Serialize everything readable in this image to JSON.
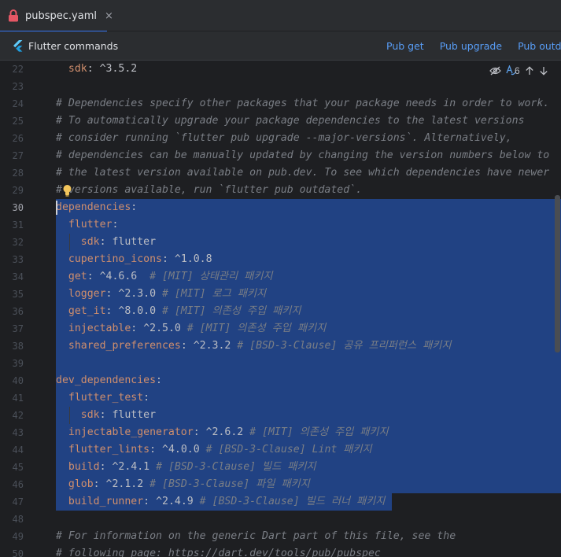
{
  "tab": {
    "label": "pubspec.yaml",
    "close": "×"
  },
  "notification": {
    "title": "Flutter commands",
    "actions": [
      "Pub get",
      "Pub upgrade",
      "Pub outdated"
    ]
  },
  "inspection": {
    "count": "6"
  },
  "editor": {
    "current_line": 30,
    "lines": [
      {
        "n": "22",
        "indent": 1,
        "key": "sdk",
        "value": " ^3.5.2",
        "comment": ""
      },
      {
        "n": "23",
        "text": ""
      },
      {
        "n": "24",
        "fullcomment": "# Dependencies specify other packages that your package needs in order to work."
      },
      {
        "n": "25",
        "fullcomment": "# To automatically upgrade your package dependencies to the latest versions"
      },
      {
        "n": "26",
        "fullcomment": "# consider running `flutter pub upgrade --major-versions`. Alternatively,"
      },
      {
        "n": "27",
        "fullcomment": "# dependencies can be manually updated by changing the version numbers below to"
      },
      {
        "n": "28",
        "fullcomment": "# the latest version available on pub.dev. To see which dependencies have newer"
      },
      {
        "n": "29",
        "fullcomment": "# versions available, run `flutter pub outdated`."
      },
      {
        "n": "30",
        "indent": 0,
        "key": "dependencies",
        "value": "",
        "comment": ""
      },
      {
        "n": "31",
        "indent": 1,
        "key": "flutter",
        "value": "",
        "comment": ""
      },
      {
        "n": "32",
        "indent": 2,
        "key": "sdk",
        "value": " flutter",
        "comment": ""
      },
      {
        "n": "33",
        "indent": 1,
        "key": "cupertino_icons",
        "value": " ^1.0.8",
        "comment": ""
      },
      {
        "n": "34",
        "indent": 1,
        "key": "get",
        "value": " ^4.6.6  ",
        "comment": "# [MIT] 상태관리 패키지"
      },
      {
        "n": "35",
        "indent": 1,
        "key": "logger",
        "value": " ^2.3.0 ",
        "comment": "# [MIT] 로그 패키지"
      },
      {
        "n": "36",
        "indent": 1,
        "key": "get_it",
        "value": " ^8.0.0 ",
        "comment": "# [MIT] 의존성 주입 패키지"
      },
      {
        "n": "37",
        "indent": 1,
        "key": "injectable",
        "value": " ^2.5.0 ",
        "comment": "# [MIT] 의존성 주입 패키지"
      },
      {
        "n": "38",
        "indent": 1,
        "key": "shared_preferences",
        "value": " ^2.3.2 ",
        "comment": "# [BSD-3-Clause] 공유 프리퍼런스 패키지"
      },
      {
        "n": "39",
        "text": ""
      },
      {
        "n": "40",
        "indent": 0,
        "key": "dev_dependencies",
        "value": "",
        "comment": ""
      },
      {
        "n": "41",
        "indent": 1,
        "key": "flutter_test",
        "value": "",
        "comment": ""
      },
      {
        "n": "42",
        "indent": 2,
        "key": "sdk",
        "value": " flutter",
        "comment": ""
      },
      {
        "n": "43",
        "indent": 1,
        "key": "injectable_generator",
        "value": " ^2.6.2 ",
        "comment": "# [MIT] 의존성 주입 패키지"
      },
      {
        "n": "44",
        "indent": 1,
        "key": "flutter_lints",
        "value": " ^4.0.0 ",
        "comment": "# [BSD-3-Clause] Lint 패키지"
      },
      {
        "n": "45",
        "indent": 1,
        "key": "build",
        "value": " ^2.4.1 ",
        "comment": "# [BSD-3-Clause] 빌드 패키지"
      },
      {
        "n": "46",
        "indent": 1,
        "key": "glob",
        "value": " ^2.1.2 ",
        "comment": "# [BSD-3-Clause] 파일 패키지"
      },
      {
        "n": "47",
        "indent": 1,
        "key": "build_runner",
        "value": " ^2.4.9 ",
        "comment": "# [BSD-3-Clause] 빌드 러너 패키지"
      },
      {
        "n": "48",
        "text": ""
      },
      {
        "n": "49",
        "fullcomment": "# For information on the generic Dart part of this file, see the"
      },
      {
        "n": "50",
        "fullcomment": "# following page: https://dart.dev/tools/pub/pubspec"
      }
    ]
  },
  "colors": {
    "background": "#1e1f22",
    "toolbar": "#2b2d30",
    "selection": "#214283",
    "key": "#cf8e6d",
    "comment": "#7a7e85",
    "link": "#589df6",
    "tab_underline": "#3574f0"
  },
  "icons": [
    "lock-icon",
    "close-icon",
    "flutter-icon",
    "eye-off-icon",
    "spellcheck-icon",
    "arrow-up-icon",
    "arrow-down-icon",
    "bulb-icon"
  ]
}
